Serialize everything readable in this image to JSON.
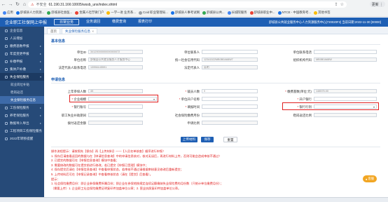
{
  "browser": {
    "insecure_label": "不安全",
    "url": "61.190.31.166:10005/wssb_unx/index.shtml",
    "profile_label": "更新 ⋮",
    "bookmarks": [
      {
        "label": "应用",
        "color": "#4285f4"
      },
      {
        "label": "舒城县人力资源...",
        "color": "#1a73e8"
      },
      {
        "label": "舒城县社会医...",
        "color": "#34a853"
      },
      {
        "label": "金属人社厅微门户",
        "color": "#ea4335"
      },
      {
        "label": "一学一进 业务系...",
        "color": "#fbbc05"
      },
      {
        "label": "Coid 职业管理局...",
        "color": "#9aa0a6"
      },
      {
        "label": "舒城县人事考试网",
        "color": "#1a73e8"
      },
      {
        "label": "舒城县公共...",
        "color": "#34a853"
      },
      {
        "label": "长城院服务",
        "color": "#4285f4"
      },
      {
        "label": "舒城县职业中...",
        "color": "#ea4335"
      },
      {
        "label": "NTCE - 中国教育考...",
        "color": "#1a73e8"
      },
      {
        "label": "其他书签",
        "color": "#fbbc05"
      }
    ]
  },
  "header": {
    "app_title": "企业职工社保网上申报",
    "tabs": [
      {
        "label": "日常业务",
        "active": true
      },
      {
        "label": "业务退回",
        "active": false
      },
      {
        "label": "缴费查询",
        "active": false
      },
      {
        "label": "报表打印",
        "active": false
      }
    ],
    "user_info": "舒城县公共就业服务中心人力资源服务中心[720020F2]  当前日期:2022-11-30  [00000]"
  },
  "sidebar": {
    "items": [
      {
        "label": "企业信息",
        "type": "item",
        "active": false
      },
      {
        "label": "人员增加",
        "type": "item",
        "active": false
      },
      {
        "label": "缴费基数申报",
        "type": "item",
        "active": false
      },
      {
        "label": "年度变更申报",
        "type": "item",
        "active": false
      },
      {
        "label": "补缴申报",
        "type": "item",
        "active": false
      },
      {
        "label": "集体户补缴",
        "type": "item",
        "active": false
      },
      {
        "label": "失业保险服务",
        "type": "item",
        "active": true
      },
      {
        "label": "就业岗位补贴",
        "type": "sub",
        "active": false
      },
      {
        "label": "稳岗返还",
        "type": "sub",
        "active": false
      },
      {
        "label": "失业保险服务信息",
        "type": "sub",
        "active": true
      },
      {
        "label": "工伤保险服务",
        "type": "item",
        "active": false
      },
      {
        "label": "养老保险服务",
        "type": "item",
        "active": false
      },
      {
        "label": "数据导入导出",
        "type": "item",
        "active": false
      },
      {
        "label": "工程项目工伤保险服务",
        "type": "item",
        "active": false
      },
      {
        "label": "2022年转移提醒",
        "type": "item",
        "active": false
      }
    ]
  },
  "page_tabs": [
    {
      "label": "首页",
      "active": false
    },
    {
      "label": "失业保险服务信息",
      "active": true
    }
  ],
  "basic_info": {
    "title": "基本信息",
    "fields": [
      {
        "label": "单位ID",
        "value": "34120000000000000072"
      },
      {
        "label": "单位联系人",
        "value": ""
      },
      {
        "label": "单位联系电话",
        "value": ""
      },
      {
        "label": "单位名称",
        "value": "舒城县公共就业服务人才服务中心"
      },
      {
        "label": "统一社会信用代码",
        "value": "12341522MB0B0A68W7"
      },
      {
        "label": "组织机构代码",
        "value": "MB0B0A68W"
      },
      {
        "label": "法定代表人联系电话",
        "value": "13956145591"
      },
      {
        "label": "法定代表人",
        "value": "吴明"
      }
    ]
  },
  "apply_info": {
    "title": "申请信息",
    "fields": [
      {
        "label": "上年参保人数",
        "value": "45",
        "required": false
      },
      {
        "label": "裁员人数",
        "value": "0",
        "required": true
      },
      {
        "label": "缴费基数(单位:元)",
        "value": "148575.00",
        "required": true
      },
      {
        "label": "企业规模",
        "value": "",
        "required": true,
        "select": true
      },
      {
        "label": "单位开户名称",
        "value": "",
        "required": true
      },
      {
        "label": "开户银行",
        "value": "",
        "required": true
      },
      {
        "label": "银行账号",
        "value": "",
        "required": true
      },
      {
        "label": "填报时间",
        "value": "",
        "required": true
      },
      {
        "label": "银行行别",
        "value": "",
        "required": true,
        "select": true
      },
      {
        "label": "职工失业补助期间",
        "value": "",
        "required": false
      },
      {
        "label": "社会保险缴费月份",
        "value": "",
        "required": false
      },
      {
        "label": "稳岗返还比例",
        "value": "",
        "required": false
      },
      {
        "label": "拨付返还金额",
        "value": "",
        "required": false
      },
      {
        "label": "申请比例",
        "value": "",
        "required": false
      }
    ]
  },
  "buttons": {
    "upload": "上传材料",
    "save": "保存",
    "reset": "重置"
  },
  "tips": [
    "操作流程提示：请按照先【保存】再【上传材料】——【人员名单核查】顺序进行申报！",
    "1. 保存后请查看返回的数据与在【申请信息查询】中的申请信息核对，核对无误后，再进行材料上传，否则可能会造成审核不通过！",
    "2. 已提交的数据可在【申报信息查询】模块中查看；",
    "3. 需要修改的数据可在提交前进行修改，若已提交【申报已受理】模块中；",
    "4. 保存提交后请在【申报信息查询】中查看申报状态，若审核不通过请根据审核意见修改后重新提交；",
    "5. 上传材料后可在【申报记录查询】中查看审核状态（请在【提交】后查看）。",
    "提示：",
    "1. 社会保险缴费月份：即企业参保缴费所属月份；即企业在参保地按规定连续足额缴纳失业保险费的月份数（只统计单位缴费月份）；",
    "（需要上传）1. 企业职工社会保险缴费证明复印件加盖单位公章；2. 营业执照复印件加盖单位公章。"
  ],
  "float_button": "客服",
  "colors": {
    "primary": "#1e5fb4",
    "sidebar": "#264a78",
    "highlight": "#e02020"
  }
}
